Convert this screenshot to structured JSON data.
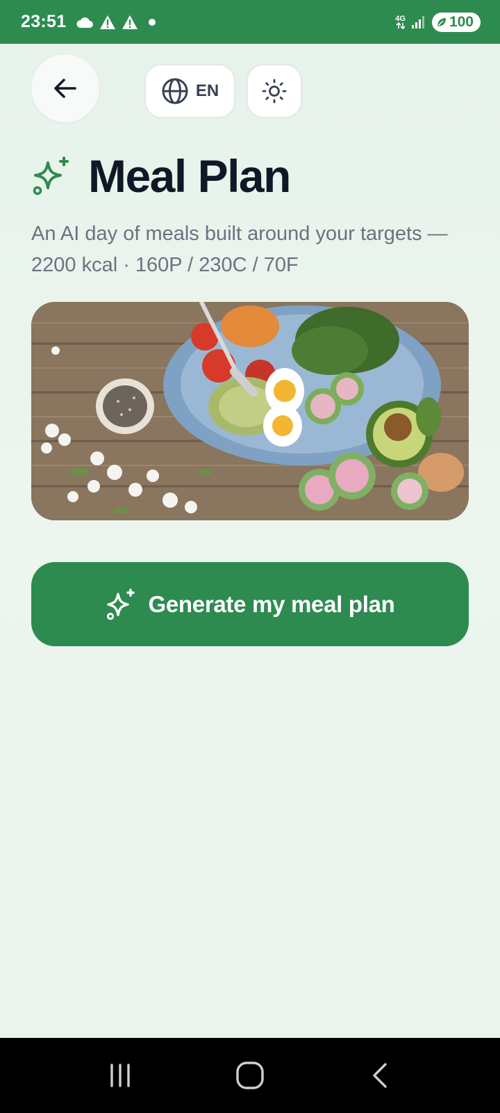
{
  "status_bar": {
    "time": "23:51",
    "network": "4G",
    "battery": "100"
  },
  "header": {
    "language_label": "EN"
  },
  "page": {
    "title": "Meal Plan",
    "subtitle": "An AI day of meals built around your targets — 2200 kcal · 160P / 230C / 70F"
  },
  "actions": {
    "generate_label": "Generate my meal plan"
  },
  "colors": {
    "brand_green": "#2e8b50",
    "title_dark": "#101828",
    "subtitle_gray": "#6b7280"
  },
  "icons": {
    "back": "arrow-left-icon",
    "language": "globe-icon",
    "theme": "sun-icon",
    "title": "sparkles-icon",
    "generate": "sparkles-icon"
  }
}
